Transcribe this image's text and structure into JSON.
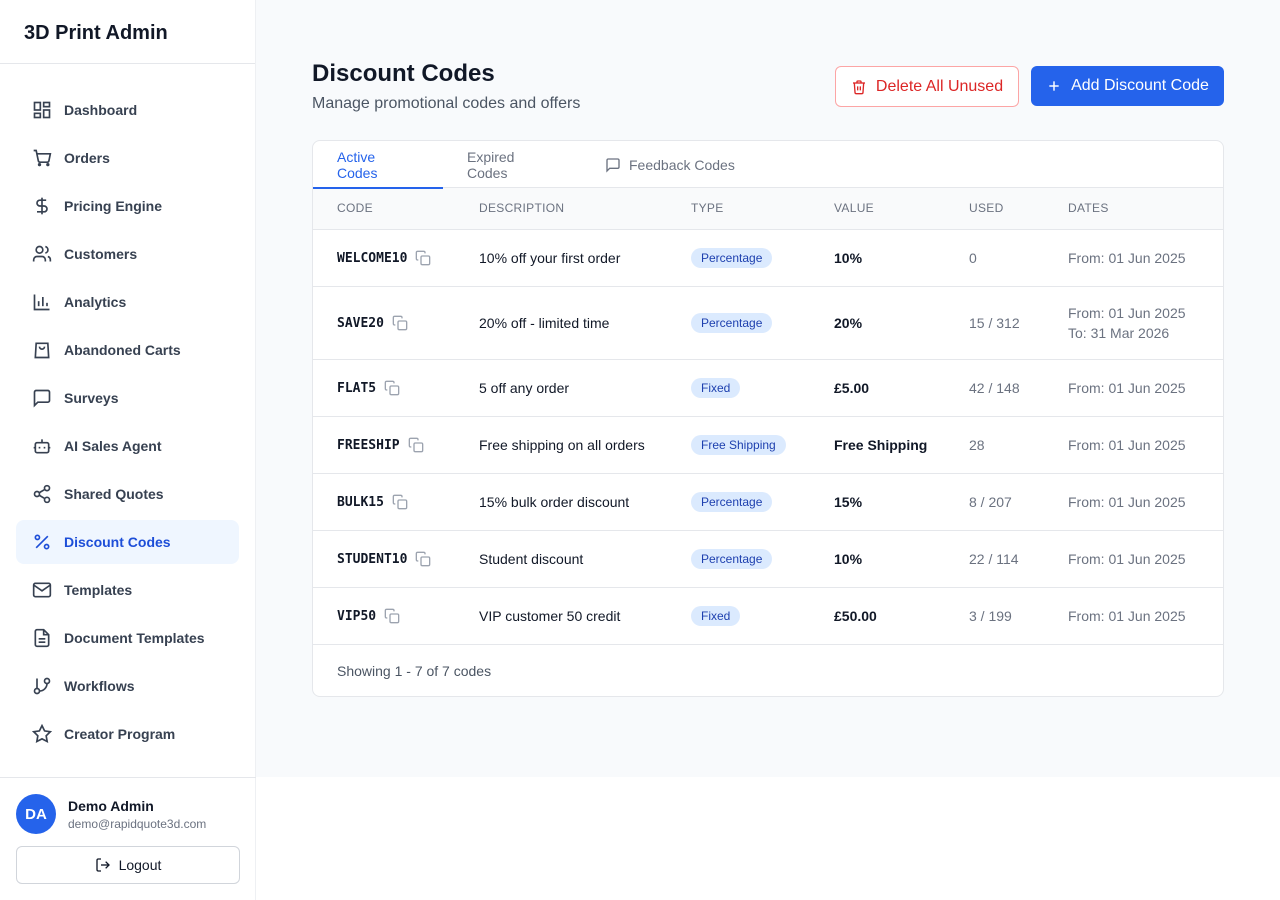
{
  "app": {
    "title": "3D Print Admin"
  },
  "sidebar": {
    "items": [
      {
        "label": "Dashboard",
        "icon": "dashboard-icon"
      },
      {
        "label": "Orders",
        "icon": "cart-icon"
      },
      {
        "label": "Pricing Engine",
        "icon": "dollar-icon"
      },
      {
        "label": "Customers",
        "icon": "users-icon"
      },
      {
        "label": "Analytics",
        "icon": "bar-chart-icon"
      },
      {
        "label": "Abandoned Carts",
        "icon": "shopping-bag-icon"
      },
      {
        "label": "Surveys",
        "icon": "message-square-icon"
      },
      {
        "label": "AI Sales Agent",
        "icon": "bot-icon"
      },
      {
        "label": "Shared Quotes",
        "icon": "share-icon"
      },
      {
        "label": "Discount Codes",
        "icon": "percent-icon",
        "active": true
      },
      {
        "label": "Templates",
        "icon": "mail-icon"
      },
      {
        "label": "Document Templates",
        "icon": "file-text-icon"
      },
      {
        "label": "Workflows",
        "icon": "git-branch-icon"
      },
      {
        "label": "Creator Program",
        "icon": "star-icon"
      }
    ]
  },
  "user": {
    "initials": "DA",
    "name": "Demo Admin",
    "email": "demo@rapidquote3d.com",
    "logout_label": "Logout"
  },
  "header": {
    "title": "Discount Codes",
    "subtitle": "Manage promotional codes and offers",
    "delete_label": "Delete All Unused",
    "add_label": "Add Discount Code"
  },
  "tabs": [
    {
      "label": "Active Codes",
      "active": true
    },
    {
      "label": "Expired Codes"
    },
    {
      "label": "Feedback Codes"
    }
  ],
  "table": {
    "columns": [
      "CODE",
      "DESCRIPTION",
      "TYPE",
      "VALUE",
      "USED",
      "DATES"
    ],
    "rows": [
      {
        "code": "WELCOME10",
        "description": "10% off your first order",
        "type": "Percentage",
        "value": "10%",
        "used": "0",
        "from": "From: 01 Jun 2025",
        "to": ""
      },
      {
        "code": "SAVE20",
        "description": "20% off - limited time",
        "type": "Percentage",
        "value": "20%",
        "used": "15 / 312",
        "from": "From: 01 Jun 2025",
        "to": "To: 31 Mar 2026"
      },
      {
        "code": "FLAT5",
        "description": "5 off any order",
        "type": "Fixed",
        "value": "£5.00",
        "used": "42 / 148",
        "from": "From: 01 Jun 2025",
        "to": ""
      },
      {
        "code": "FREESHIP",
        "description": "Free shipping on all orders",
        "type": "Free Shipping",
        "value": "Free Shipping",
        "used": "28",
        "from": "From: 01 Jun 2025",
        "to": ""
      },
      {
        "code": "BULK15",
        "description": "15% bulk order discount",
        "type": "Percentage",
        "value": "15%",
        "used": "8 / 207",
        "from": "From: 01 Jun 2025",
        "to": ""
      },
      {
        "code": "STUDENT10",
        "description": "Student discount",
        "type": "Percentage",
        "value": "10%",
        "used": "22 / 114",
        "from": "From: 01 Jun 2025",
        "to": ""
      },
      {
        "code": "VIP50",
        "description": "VIP customer 50 credit",
        "type": "Fixed",
        "value": "£50.00",
        "used": "3 / 199",
        "from": "From: 01 Jun 2025",
        "to": ""
      }
    ],
    "footer": "Showing 1 - 7 of 7 codes"
  },
  "colors": {
    "accent": "#2563eb",
    "danger": "#dc2626",
    "badge_bg": "#dbeafe"
  }
}
